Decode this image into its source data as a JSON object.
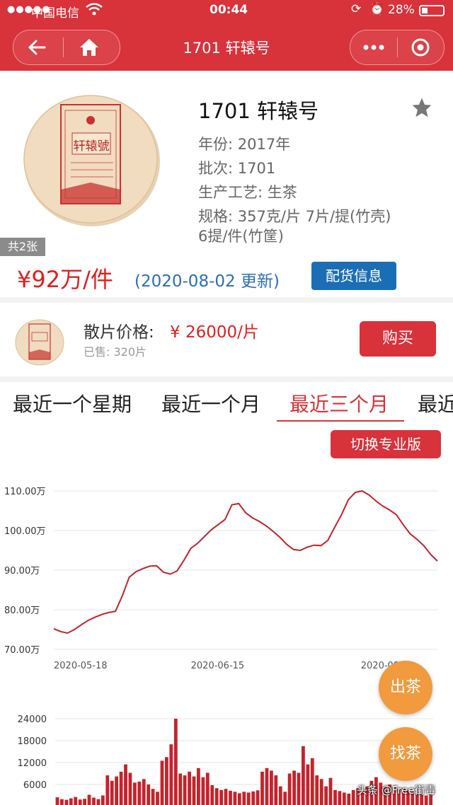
{
  "status_bar": {
    "carrier": "中国电信",
    "time": "00:44",
    "battery": "28%"
  },
  "nav": {
    "title": "1701 轩辕号"
  },
  "product": {
    "name": "1701 轩辕号",
    "image_count": "共2张",
    "cake_label": "轩辕號",
    "year": "年份: 2017年",
    "batch": "批次: 1701",
    "process": "生产工艺: 生茶",
    "spec_line1": "规格: 357克/片 7片/提(竹壳)",
    "spec_line2": "6提/件(竹筐)",
    "price": "¥92万/件",
    "updated": "(2020-08-02 更新)",
    "supply_button": "配货信息"
  },
  "single": {
    "label": "散片价格:",
    "price": "¥ 26000/片",
    "sold": "已售: 320片",
    "buy_button": "购买"
  },
  "tabs": [
    "最近一个星期",
    "最近一个月",
    "最近三个月",
    "最近"
  ],
  "active_tab": 2,
  "pro_button": "切换专业版",
  "fab": {
    "sell": "出茶",
    "find": "找茶"
  },
  "watermark": "头条 @Free街毒",
  "colors": {
    "brand_red": "#d8323a",
    "blue_button": "#1b6db5",
    "orange_fab": "#f19a3e",
    "price_blue": "#2a6fb8"
  },
  "chart_data": [
    {
      "type": "line",
      "title": "",
      "ylabel": "",
      "ylim": [
        70,
        110
      ],
      "y_ticks": [
        "110.00万",
        "100.00万",
        "90.00万",
        "80.00万",
        "70.00万"
      ],
      "x_ticks": [
        "2020-05-18",
        "2020-06-15",
        "2020-08-02"
      ],
      "series": [
        {
          "values": [
            75.2,
            74.5,
            74.1,
            75.0,
            76.2,
            77.3,
            78.1,
            78.8,
            79.3,
            79.6,
            83.5,
            88.2,
            89.6,
            90.4,
            91.0,
            91.1,
            89.5,
            89.0,
            89.8,
            92.5,
            95.5,
            96.8,
            98.5,
            100.2,
            101.5,
            102.8,
            106.5,
            106.8,
            104.5,
            103.2,
            102.3,
            101.2,
            99.8,
            98.3,
            96.5,
            95.2,
            95.0,
            95.8,
            96.3,
            96.2,
            97.5,
            100.8,
            104.0,
            107.8,
            109.6,
            110.0,
            109.0,
            107.5,
            106.2,
            105.2,
            104.0,
            101.5,
            99.2,
            97.8,
            96.2,
            94.0,
            92.3
          ]
        }
      ]
    },
    {
      "type": "bar",
      "title": "",
      "ylim": [
        0,
        26000
      ],
      "y_ticks": [
        "24000",
        "18000",
        "12000",
        "6000"
      ],
      "values": [
        2500,
        2000,
        1800,
        2200,
        2600,
        1900,
        2100,
        3200,
        2400,
        2000,
        3000,
        8500,
        7000,
        8200,
        9500,
        11500,
        9200,
        6500,
        6800,
        7500,
        6000,
        4800,
        4000,
        12500,
        13500,
        17000,
        24000,
        9000,
        8500,
        9500,
        8200,
        10500,
        8000,
        9200,
        5800,
        5000,
        4500,
        4800,
        4300,
        4000,
        3600,
        4000,
        3800,
        4100,
        4400,
        9500,
        10500,
        9800,
        8500,
        5500,
        4000,
        9000,
        9800,
        9200,
        16500,
        11500,
        13200,
        8500,
        7500,
        5500,
        7800,
        4500,
        4200,
        3800,
        3500,
        4500,
        5000,
        4600,
        5500,
        7000,
        8000,
        6500,
        5500,
        6000,
        5200,
        4800,
        5000,
        4500,
        4000,
        3500,
        3500,
        3000,
        3200
      ]
    }
  ]
}
